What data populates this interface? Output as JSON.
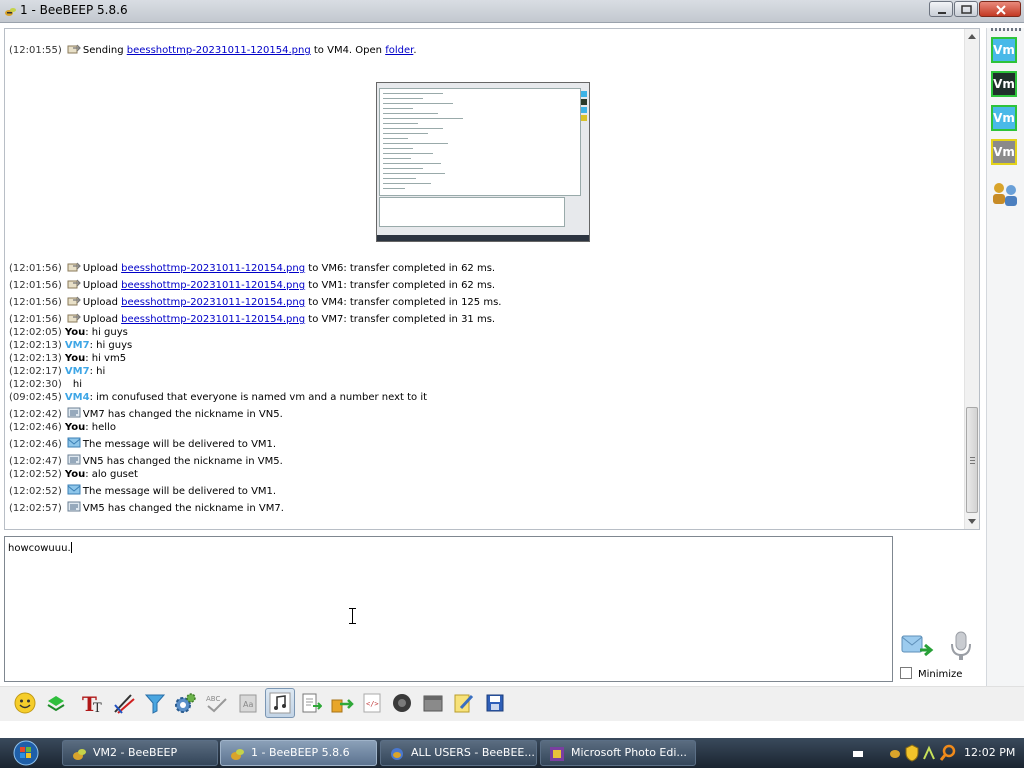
{
  "window": {
    "title": "1 - BeeBEEP 5.8.6"
  },
  "chat": {
    "lines": [
      {
        "ts": "(12:01:55)",
        "pre": "Sending ",
        "link": "beesshottmp-20231011-120154.png",
        "mid": " to VM4. Open ",
        "link2": "folder",
        "post": "."
      },
      {
        "ts": "(12:01:56)",
        "pre": "Upload ",
        "link": "beesshottmp-20231011-120154.png",
        "post": " to VM6: transfer completed in 62 ms."
      },
      {
        "ts": "(12:01:56)",
        "pre": "Upload ",
        "link": "beesshottmp-20231011-120154.png",
        "post": " to VM1: transfer completed in 62 ms."
      },
      {
        "ts": "(12:01:56)",
        "pre": "Upload ",
        "link": "beesshottmp-20231011-120154.png",
        "post": " to VM4: transfer completed in 125 ms."
      },
      {
        "ts": "(12:01:56)",
        "pre": "Upload ",
        "link": "beesshottmp-20231011-120154.png",
        "post": " to VM7: transfer completed in 31 ms."
      },
      {
        "ts": "(12:02:05)",
        "who": "You",
        "text": ": hi guys"
      },
      {
        "ts": "(12:02:13)",
        "who": "VM7",
        "text": ": hi guys"
      },
      {
        "ts": "(12:02:13)",
        "who": "You",
        "text": ": hi vm5"
      },
      {
        "ts": "(12:02:17)",
        "who": "VM7",
        "text": ": hi"
      },
      {
        "ts": "(12:02:30)",
        "text": "hi"
      },
      {
        "ts": "(09:02:45)",
        "who": "VM4",
        "text": ": im conufused that everyone is named vm and a number next to it"
      },
      {
        "ts": "(12:02:42)",
        "text": "VM7 has changed the nickname in VN5."
      },
      {
        "ts": "(12:02:46)",
        "who": "You",
        "text": ": hello"
      },
      {
        "ts": "(12:02:46)",
        "text": "The message will be delivered to VM1."
      },
      {
        "ts": "(12:02:47)",
        "text": "VN5 has changed the nickname in VM5."
      },
      {
        "ts": "(12:02:52)",
        "who": "You",
        "text": ": alo guset"
      },
      {
        "ts": "(12:02:52)",
        "text": "The message will be delivered to VM1."
      },
      {
        "ts": "(12:02:57)",
        "text": "VM5 has changed the nickname in VM7."
      }
    ]
  },
  "users": [
    {
      "label": "Vm",
      "bg": "#49b9e8",
      "border": "#2dc33a"
    },
    {
      "label": "Vm",
      "bg": "#1f2f2a",
      "border": "#2dc33a"
    },
    {
      "label": "Vm",
      "bg": "#49b9e8",
      "border": "#2dc33a"
    },
    {
      "label": "Vm",
      "bg": "#8a8a8a",
      "border": "#e3d21a"
    }
  ],
  "input": {
    "value": "howcowuuu."
  },
  "minimize_label": "Minimize",
  "toolbar_icons": [
    "emoticon-icon",
    "send-file-icon",
    "font-icon",
    "color-icon",
    "filter-icon",
    "settings-icon",
    "spellcheck-icon",
    "dictionary-icon",
    "music-icon",
    "save-chat-icon",
    "share-icon",
    "html-icon",
    "screenshot-icon",
    "clear-icon",
    "note-icon",
    "save-icon"
  ],
  "taskbar": {
    "items": [
      {
        "label": "VM2 - BeeBEEP",
        "active": false
      },
      {
        "label": "1 - BeeBEEP 5.8.6",
        "active": true
      },
      {
        "label": "ALL USERS - BeeBEE...",
        "active": false
      },
      {
        "label": "Microsoft Photo Edi...",
        "active": false
      }
    ],
    "clock": "12:02 PM"
  }
}
